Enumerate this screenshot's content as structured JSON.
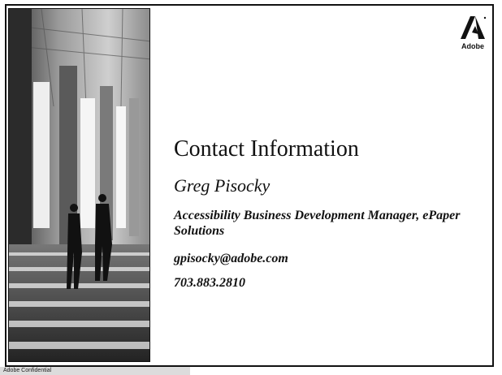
{
  "logo": {
    "word": "Adobe",
    "icon": "adobe-logo-icon"
  },
  "contact": {
    "title": "Contact Information",
    "name": "Greg Pisocky",
    "role": "Accessibility Business Development Manager, ePaper Solutions",
    "email": "gpisocky@adobe.com",
    "phone": "703.883.2810"
  },
  "footer": {
    "text": "Adobe Confidential"
  }
}
